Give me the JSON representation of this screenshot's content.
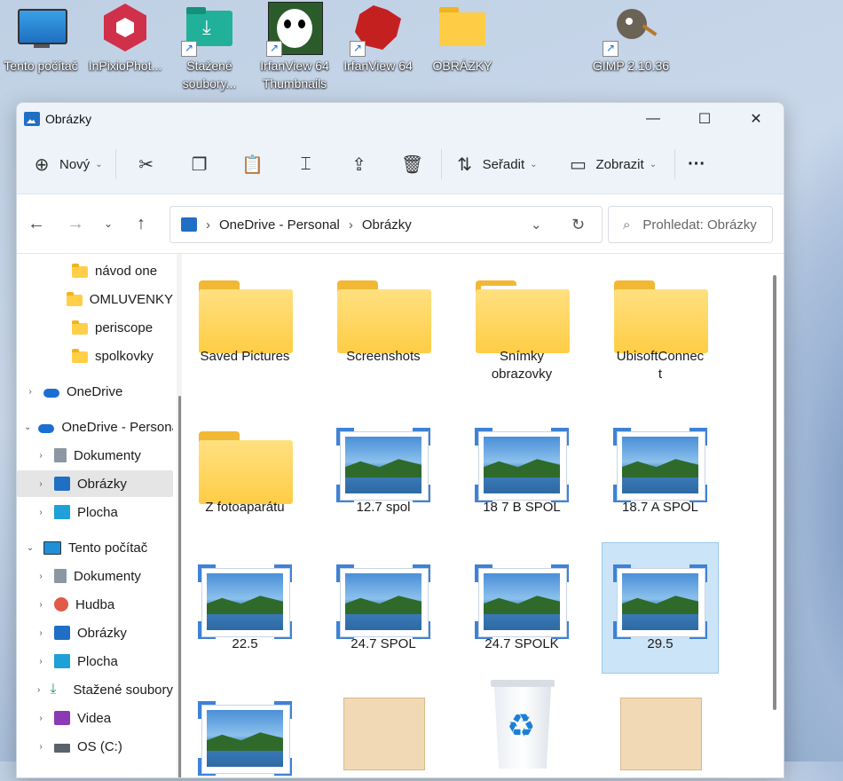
{
  "desktop": {
    "icons": [
      {
        "label": "Tento počítač",
        "icon": "monitor-icon",
        "shortcut": false
      },
      {
        "label": "InPixioPhot...",
        "icon": "inpixio-icon",
        "shortcut": false
      },
      {
        "label": "Stažené\nsoubory...",
        "icon": "download-folder-icon",
        "shortcut": true
      },
      {
        "label": "IrfanView 64\nThumbnails",
        "icon": "panda-icon",
        "shortcut": true
      },
      {
        "label": "IrfanView 64",
        "icon": "irfanview-icon",
        "shortcut": true
      },
      {
        "label": "OBRÁZKY",
        "icon": "folder-icon",
        "shortcut": false
      },
      {
        "label": "GIMP 2.10.36",
        "icon": "gimp-icon",
        "shortcut": true
      }
    ]
  },
  "window": {
    "title": "Obrázky",
    "controls": {
      "minimize": "—",
      "maximize": "☐",
      "close": "✕"
    }
  },
  "toolbar": {
    "new_label": "Nový",
    "sort_label": "Seřadit",
    "view_label": "Zobrazit",
    "more_label": "···"
  },
  "address": {
    "crumbs": [
      "OneDrive - Personal",
      "Obrázky"
    ],
    "search_placeholder": "Prohledat: Obrázky"
  },
  "nav": {
    "items": [
      {
        "label": "návod one",
        "indent": 2,
        "icon": "folder-icon",
        "chevron": ""
      },
      {
        "label": "OMLUVENKY",
        "indent": 2,
        "icon": "folder-icon",
        "chevron": ""
      },
      {
        "label": "periscope",
        "indent": 2,
        "icon": "folder-icon",
        "chevron": ""
      },
      {
        "label": "spolkovky",
        "indent": 2,
        "icon": "folder-icon",
        "chevron": ""
      },
      {
        "label": "OneDrive",
        "indent": 0,
        "icon": "cloud-icon",
        "chevron": "›"
      },
      {
        "label": "OneDrive - Personal",
        "indent": 0,
        "icon": "cloud-icon",
        "chevron": "⌄"
      },
      {
        "label": "Dokumenty",
        "indent": 1,
        "icon": "documents-icon",
        "chevron": "›"
      },
      {
        "label": "Obrázky",
        "indent": 1,
        "icon": "pictures-icon",
        "chevron": "›",
        "selected": true
      },
      {
        "label": "Plocha",
        "indent": 1,
        "icon": "desktop-icon",
        "chevron": "›"
      },
      {
        "label": "Tento počítač",
        "indent": 0,
        "icon": "monitor-icon",
        "chevron": "⌄"
      },
      {
        "label": "Dokumenty",
        "indent": 1,
        "icon": "documents-icon",
        "chevron": "›"
      },
      {
        "label": "Hudba",
        "indent": 1,
        "icon": "music-icon",
        "chevron": "›"
      },
      {
        "label": "Obrázky",
        "indent": 1,
        "icon": "pictures-icon",
        "chevron": "›"
      },
      {
        "label": "Plocha",
        "indent": 1,
        "icon": "desktop-icon",
        "chevron": "›"
      },
      {
        "label": "Stažené soubory",
        "indent": 1,
        "icon": "download-icon",
        "chevron": "›"
      },
      {
        "label": "Videa",
        "indent": 1,
        "icon": "video-icon",
        "chevron": "›"
      },
      {
        "label": "OS (C:)",
        "indent": 1,
        "icon": "drive-icon",
        "chevron": "›"
      }
    ]
  },
  "files": [
    {
      "label": "Saved Pictures",
      "type": "folder"
    },
    {
      "label": "Screenshots",
      "type": "folder"
    },
    {
      "label": "Snímky\nobrazovky",
      "type": "folder-paper"
    },
    {
      "label": "UbisoftConnec\nt",
      "type": "folder"
    },
    {
      "label": "Z fotoaparátu",
      "type": "folder"
    },
    {
      "label": "12.7 spol",
      "type": "image"
    },
    {
      "label": "18 7 B SPOL",
      "type": "image"
    },
    {
      "label": "18.7 A SPOL",
      "type": "image"
    },
    {
      "label": "22.5",
      "type": "image"
    },
    {
      "label": "24.7 SPOL",
      "type": "image"
    },
    {
      "label": "24.7 SPOLK",
      "type": "image"
    },
    {
      "label": "29.5",
      "type": "image",
      "selected": true
    },
    {
      "label": "",
      "type": "image"
    },
    {
      "label": "",
      "type": "spreadsheet"
    },
    {
      "label": "",
      "type": "recycle"
    },
    {
      "label": "",
      "type": "spreadsheet"
    }
  ]
}
